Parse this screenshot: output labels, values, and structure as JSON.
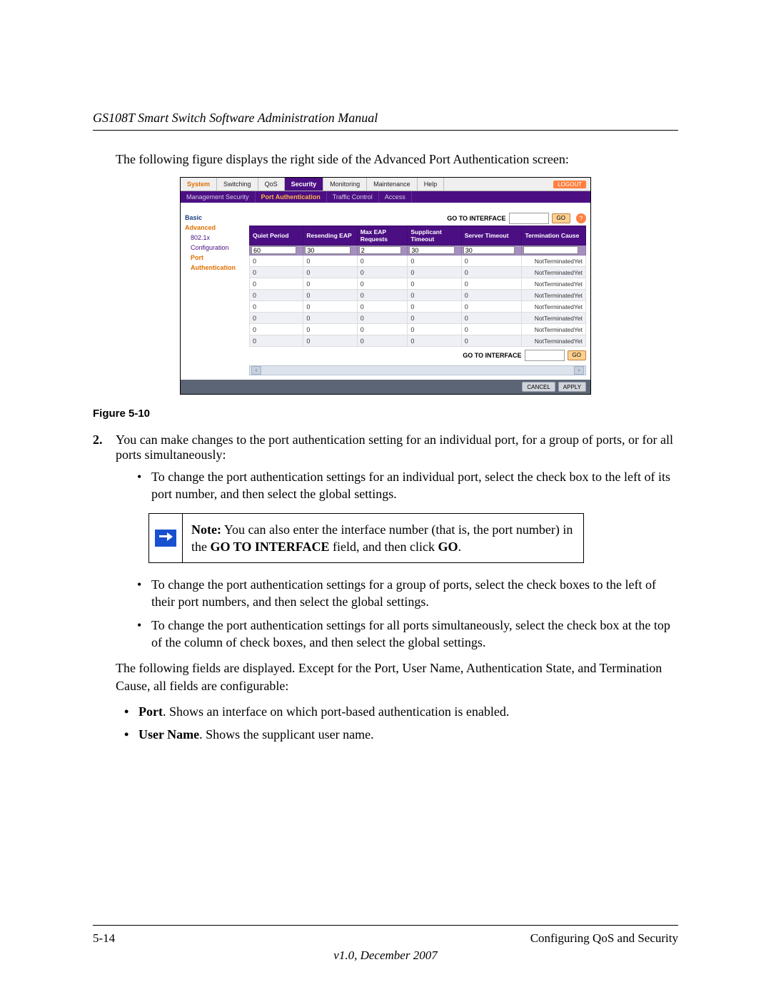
{
  "header_title": "GS108T Smart Switch Software Administration Manual",
  "intro_text": "The following figure displays the right side of the Advanced Port Authentication screen:",
  "figure_caption": "Figure 5-10",
  "screenshot": {
    "tabs": [
      "System",
      "Switching",
      "QoS",
      "Security",
      "Monitoring",
      "Maintenance",
      "Help"
    ],
    "active_tab": "Security",
    "logout_label": "LOGOUT",
    "subtabs": [
      "Management Security",
      "Port Authentication",
      "Traffic Control",
      "Access"
    ],
    "active_subtab": "Port Authentication",
    "sidebar": {
      "basic": "Basic",
      "advanced": "Advanced",
      "cfg": "802.1x Configuration",
      "pauth": "Port Authentication"
    },
    "go_to_interface_label": "GO TO INTERFACE",
    "go_button_label": "GO",
    "columns": [
      "Quiet Period",
      "Resending EAP",
      "Max EAP Requests",
      "Supplicant Timeout",
      "Server Timeout",
      "Termination Cause"
    ],
    "input_values": [
      "60",
      "30",
      "2",
      "30",
      "30",
      ""
    ],
    "rows": [
      {
        "vals": [
          "0",
          "0",
          "0",
          "0",
          "0"
        ],
        "term": "NotTerminatedYet",
        "alt": false
      },
      {
        "vals": [
          "0",
          "0",
          "0",
          "0",
          "0"
        ],
        "term": "NotTerminatedYet",
        "alt": true
      },
      {
        "vals": [
          "0",
          "0",
          "0",
          "0",
          "0"
        ],
        "term": "NotTerminatedYet",
        "alt": false
      },
      {
        "vals": [
          "0",
          "0",
          "0",
          "0",
          "0"
        ],
        "term": "NotTerminatedYet",
        "alt": true
      },
      {
        "vals": [
          "0",
          "0",
          "0",
          "0",
          "0"
        ],
        "term": "NotTerminatedYet",
        "alt": false
      },
      {
        "vals": [
          "0",
          "0",
          "0",
          "0",
          "0"
        ],
        "term": "NotTerminatedYet",
        "alt": true
      },
      {
        "vals": [
          "0",
          "0",
          "0",
          "0",
          "0"
        ],
        "term": "NotTerminatedYet",
        "alt": false
      },
      {
        "vals": [
          "0",
          "0",
          "0",
          "0",
          "0"
        ],
        "term": "NotTerminatedYet",
        "alt": true
      }
    ],
    "cancel_label": "CANCEL",
    "apply_label": "APPLY"
  },
  "step2_num": "2.",
  "step2_text": "You can make changes to the port authentication setting for an individual port, for a group of ports, or for all ports simultaneously:",
  "bullet_a": "To change the port authentication settings for an individual port, select the check box to the left of its port number, and then select the global settings.",
  "note_label": "Note:",
  "note_text_1": " You can also enter the interface number (that is, the port number) in the ",
  "note_bold_1": "GO TO INTERFACE",
  "note_text_2": " field, and then click ",
  "note_bold_2": "GO",
  "note_text_3": ".",
  "bullet_b": "To change the port authentication settings for a group of ports, select the check boxes to the left of their port numbers, and then select the global settings.",
  "bullet_c": "To change the port authentication settings for all ports simultaneously, select the check box at the top of the column of check boxes, and then select the global settings.",
  "para_fields": "The following fields are displayed. Except for the Port, User Name, Authentication State, and Termination Cause, all fields are configurable:",
  "field_port_label": "Port",
  "field_port_text": ". Shows an interface on which port-based authentication is enabled.",
  "field_user_label": "User Name",
  "field_user_text": ". Shows the supplicant user name.",
  "footer_page": "5-14",
  "footer_section": "Configuring QoS and Security",
  "footer_version": "v1.0, December 2007"
}
